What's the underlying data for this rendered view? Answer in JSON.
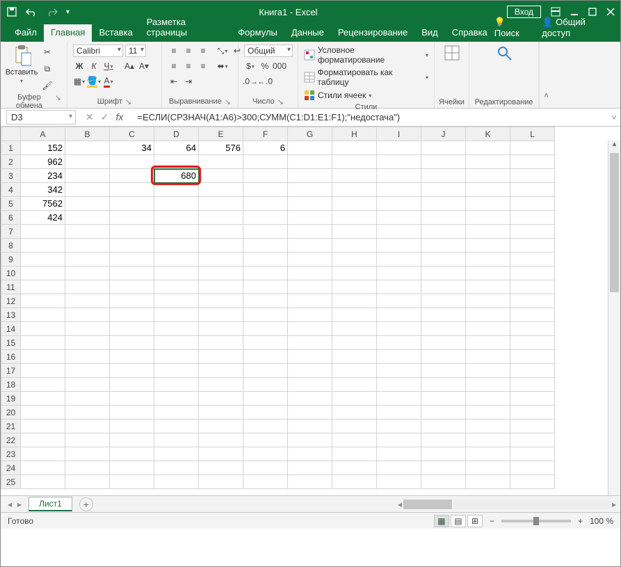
{
  "titlebar": {
    "title": "Книга1  -  Excel",
    "signin": "Вход"
  },
  "tabs": {
    "file": "Файл",
    "home": "Главная",
    "insert": "Вставка",
    "layout": "Разметка страницы",
    "formulas": "Формулы",
    "data": "Данные",
    "review": "Рецензирование",
    "view": "Вид",
    "help": "Справка",
    "search": "Поиск",
    "share": "Общий доступ"
  },
  "ribbon": {
    "clipboard": {
      "label": "Буфер обмена",
      "paste": "Вставить"
    },
    "font": {
      "label": "Шрифт",
      "name": "Calibri",
      "size": "11",
      "bold": "Ж",
      "italic": "К",
      "underline": "Ч"
    },
    "alignment": {
      "label": "Выравнивание"
    },
    "number": {
      "label": "Число",
      "format": "Общий"
    },
    "styles": {
      "label": "Стили",
      "cond": "Условное форматирование",
      "table": "Форматировать как таблицу",
      "cell": "Стили ячеек"
    },
    "cells": {
      "label": "Ячейки"
    },
    "editing": {
      "label": "Редактирование"
    }
  },
  "namebox": "D3",
  "fx": "fx",
  "formula": "=ЕСЛИ(СРЗНАЧ(A1:A6)>300;СУММ(C1:D1:E1:F1);\"недостача\")",
  "columns": [
    "A",
    "B",
    "C",
    "D",
    "E",
    "F",
    "G",
    "H",
    "I",
    "J",
    "K",
    "L"
  ],
  "row_headers": [
    1,
    2,
    3,
    4,
    5,
    6,
    7,
    8,
    9,
    10,
    11,
    12,
    13,
    14,
    15,
    16,
    17,
    18,
    19,
    20,
    21,
    22,
    23,
    24,
    25
  ],
  "cells": {
    "r1": {
      "A": "152",
      "C": "34",
      "D": "64",
      "E": "576",
      "F": "6"
    },
    "r2": {
      "A": "962"
    },
    "r3": {
      "A": "234",
      "D": "680"
    },
    "r4": {
      "A": "342"
    },
    "r5": {
      "A": "7562"
    },
    "r6": {
      "A": "424"
    }
  },
  "sheet_tab": "Лист1",
  "status": {
    "ready": "Готово",
    "zoom": "100 %"
  }
}
